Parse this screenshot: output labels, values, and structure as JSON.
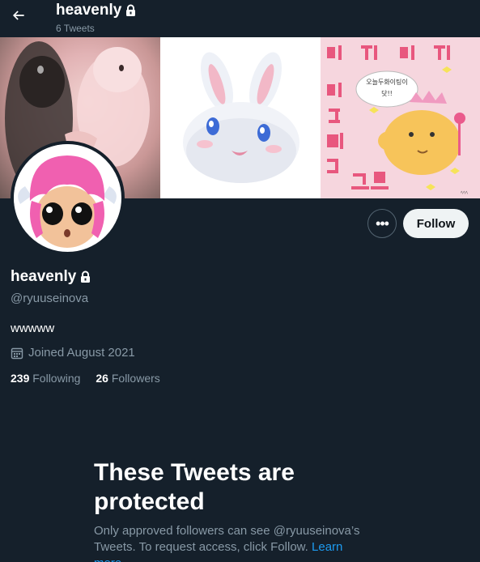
{
  "header": {
    "name": "heavenly",
    "tweet_count": "6 Tweets"
  },
  "banner": {
    "panel3_lines": [
      "오늘두화이팅이",
      "닷!!"
    ],
    "panel3_signature": "ﾍﾍﾍ"
  },
  "actions": {
    "more_label": "•••",
    "follow_label": "Follow"
  },
  "profile": {
    "display_name": "heavenly",
    "handle": "@ryuuseinova",
    "bio": "wwwww",
    "joined": "Joined August 2021",
    "following_count": "239",
    "following_label": "Following",
    "followers_count": "26",
    "followers_label": "Followers"
  },
  "protected": {
    "title": "These Tweets are protected",
    "description": "Only approved followers can see @ryuuseinova’s Tweets. To request access, click Follow.",
    "learn_more": "Learn more"
  },
  "colors": {
    "background": "#15202b",
    "secondary_text": "#8899a6",
    "link": "#1d9bf0",
    "follow_button_bg": "#eff3f4"
  }
}
